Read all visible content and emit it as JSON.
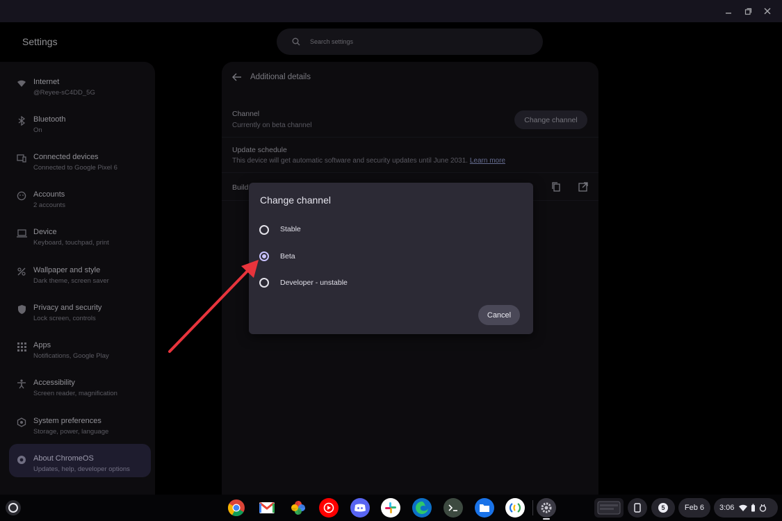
{
  "app": {
    "title": "Settings"
  },
  "search": {
    "placeholder": "Search settings"
  },
  "sidebar": {
    "items": [
      {
        "label": "Internet",
        "sub": "@Reyee-sC4DD_5G",
        "icon": "wifi-icon"
      },
      {
        "label": "Bluetooth",
        "sub": "On",
        "icon": "bluetooth-icon"
      },
      {
        "label": "Connected devices",
        "sub": "Connected to Google Pixel 6",
        "icon": "connected-devices-icon"
      },
      {
        "label": "Accounts",
        "sub": "2 accounts",
        "icon": "accounts-icon"
      },
      {
        "label": "Device",
        "sub": "Keyboard, touchpad, print",
        "icon": "laptop-icon"
      },
      {
        "label": "Wallpaper and style",
        "sub": "Dark theme, screen saver",
        "icon": "palette-icon"
      },
      {
        "label": "Privacy and security",
        "sub": "Lock screen, controls",
        "icon": "shield-icon"
      },
      {
        "label": "Apps",
        "sub": "Notifications, Google Play",
        "icon": "apps-grid-icon"
      },
      {
        "label": "Accessibility",
        "sub": "Screen reader, magnification",
        "icon": "accessibility-icon"
      },
      {
        "label": "System preferences",
        "sub": "Storage, power, language",
        "icon": "system-icon"
      },
      {
        "label": "About ChromeOS",
        "sub": "Updates, help, developer options",
        "icon": "chromeos-icon",
        "active": true
      }
    ]
  },
  "details": {
    "title": "Additional details",
    "channel": {
      "label": "Channel",
      "sub": "Currently on beta channel",
      "button": "Change channel"
    },
    "update_schedule": {
      "label": "Update schedule",
      "sub": "This device will get automatic software and security updates until June 2031.",
      "link": "Learn more"
    },
    "build": {
      "label": "Build"
    }
  },
  "dialog": {
    "title": "Change channel",
    "options": [
      {
        "label": "Stable",
        "checked": false
      },
      {
        "label": "Beta",
        "checked": true
      },
      {
        "label": "Developer - unstable",
        "checked": false
      }
    ],
    "cancel": "Cancel"
  },
  "shelf": {
    "apps": [
      "Chrome",
      "Gmail",
      "Google Photos",
      "YouTube Music",
      "Discord",
      "Slack",
      "Microsoft Edge",
      "Terminal",
      "Files",
      "Keep",
      "Settings"
    ],
    "notification_count": "5",
    "date": "Feb 6",
    "time": "3:06"
  },
  "colors": {
    "accent": "#c9c2ff",
    "annotation_arrow": "#e8343c"
  }
}
